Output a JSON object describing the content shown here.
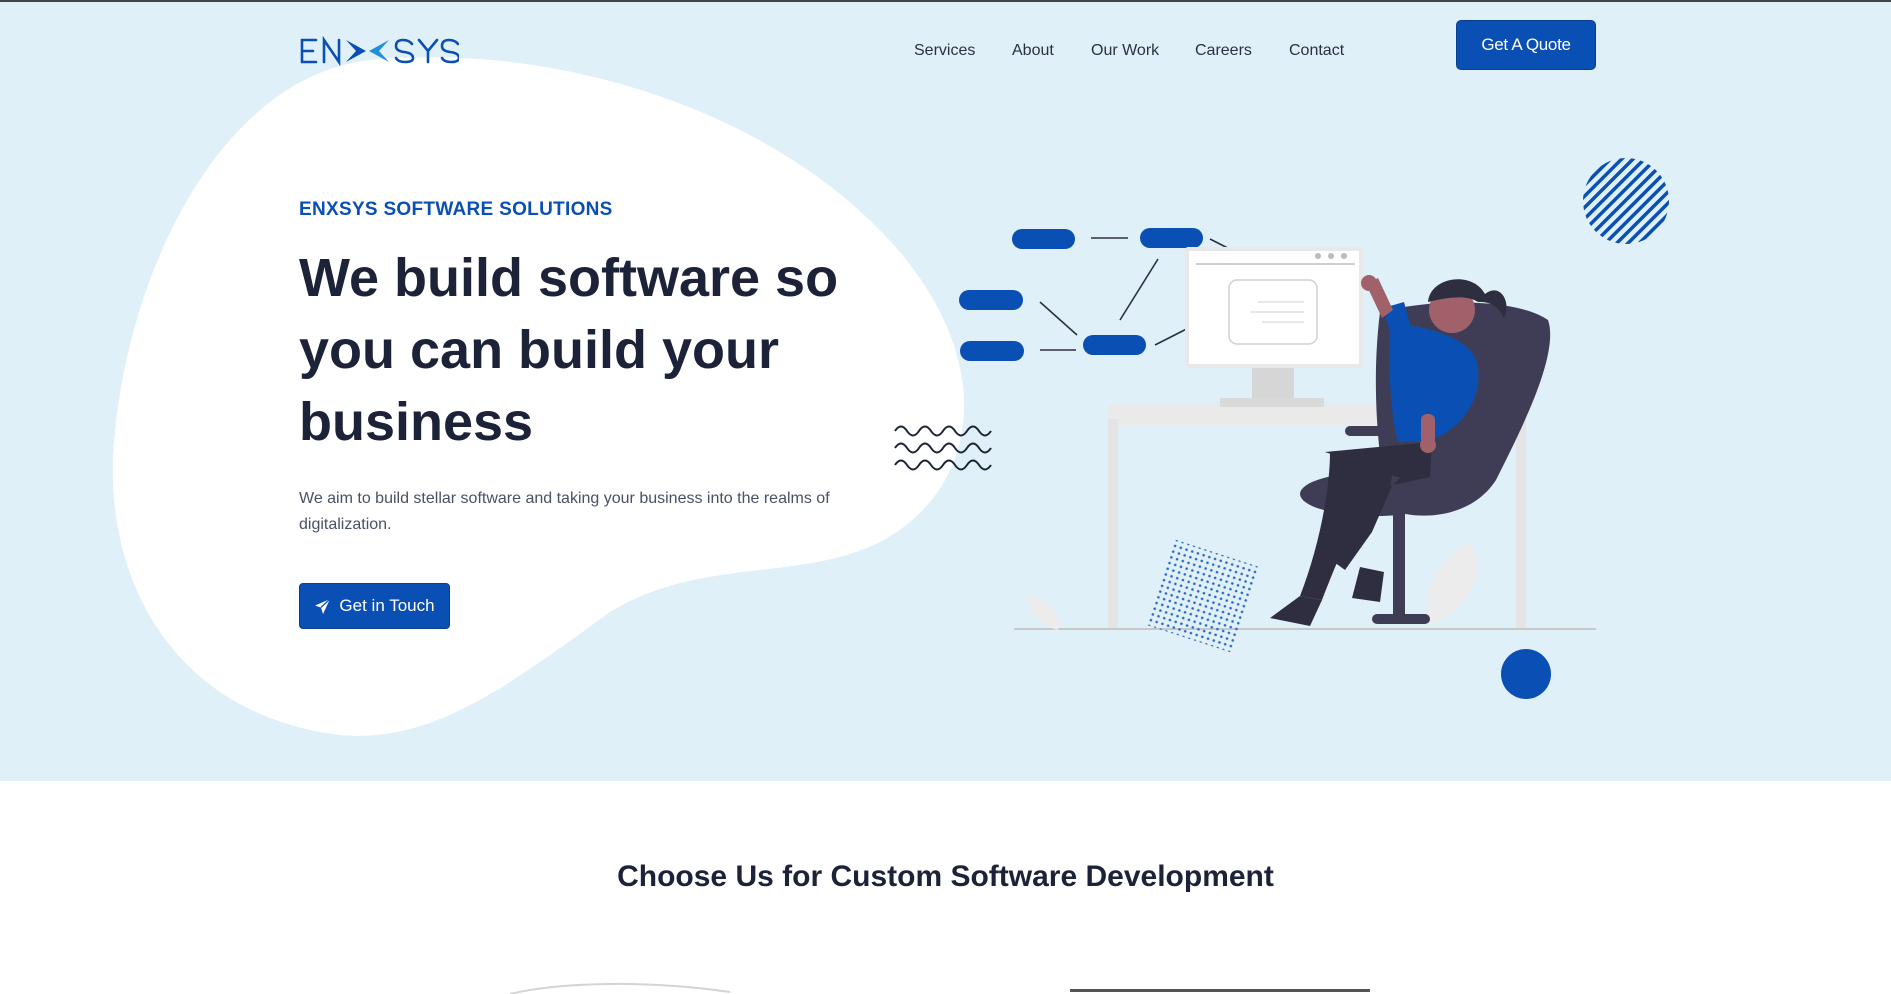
{
  "brand": {
    "logo_text": "ENXSYS"
  },
  "nav": {
    "items": [
      {
        "label": "Services"
      },
      {
        "label": "About"
      },
      {
        "label": "Our Work"
      },
      {
        "label": "Careers"
      },
      {
        "label": "Contact"
      }
    ],
    "cta_label": "Get A Quote"
  },
  "hero": {
    "eyebrow": "ENXSYS SOFTWARE SOLUTIONS",
    "headline_lines": [
      "We build software so",
      "you can build your",
      "business"
    ],
    "lead": "We aim to build stellar software and taking your business into the realms of digitalization.",
    "cta_label": "Get in Touch",
    "cta_icon": "paper-plane-icon"
  },
  "section": {
    "title": "Choose Us for Custom Software Development"
  },
  "colors": {
    "primary": "#0a4fb4",
    "hero_bg": "#e0f0f9",
    "heading": "#1c2238",
    "body_text": "#4a5066",
    "chair": "#3f3d56"
  }
}
